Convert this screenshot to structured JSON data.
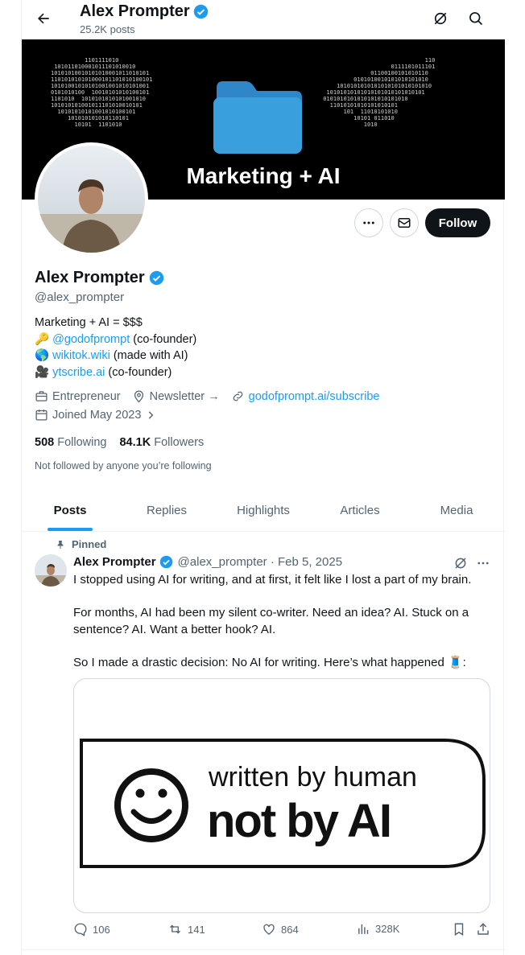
{
  "header": {
    "name": "Alex Prompter",
    "posts_count": "25.2K posts"
  },
  "banner": {
    "caption": "Marketing + AI"
  },
  "profile": {
    "name": "Alex Prompter",
    "handle": "@alex_prompter",
    "follow_label": "Follow",
    "bio": {
      "line1": "Marketing + AI = $$$",
      "line2_emoji": "🔑",
      "line2_link": "@godofprompt",
      "line2_text": "  (co-founder)",
      "line3_emoji": "🌎",
      "line3_link": "wikitok.wiki",
      "line3_text": " (made with AI)",
      "line4_emoji": "🎥",
      "line4_link": "ytscribe.ai",
      "line4_text": " (co-founder)"
    },
    "category": "Entrepreneur",
    "location": "Newsletter →",
    "website": "godofprompt.ai/subscribe",
    "joined": "Joined May 2023",
    "following_count": "508",
    "following_label": "Following",
    "followers_count": "84.1K",
    "followers_label": "Followers",
    "not_followed": "Not followed by anyone you’re following"
  },
  "tabs": [
    "Posts",
    "Replies",
    "Highlights",
    "Articles",
    "Media"
  ],
  "post": {
    "pinned_label": "Pinned",
    "author": "Alex Prompter",
    "handle_date": "@alex_prompter · Feb 5, 2025",
    "text": "I stopped using AI for writing, and at first, it felt like I lost a part of my brain.\n\nFor months, AI had been my silent co-writer. Need an idea? AI. Stuck on a sentence? AI. Want a better hook? AI.\n\nSo I made a drastic decision: No AI for writing. Here’s what happened 🧵:",
    "media_line1": "written by human",
    "media_line2": "not by AI",
    "replies": "106",
    "reposts": "141",
    "likes": "864",
    "views": "328K"
  },
  "colors": {
    "accent": "#1d9bf0",
    "text": "#0f1419",
    "muted": "#536471",
    "border": "#cfd9de",
    "folder": "#3aa0dd"
  }
}
